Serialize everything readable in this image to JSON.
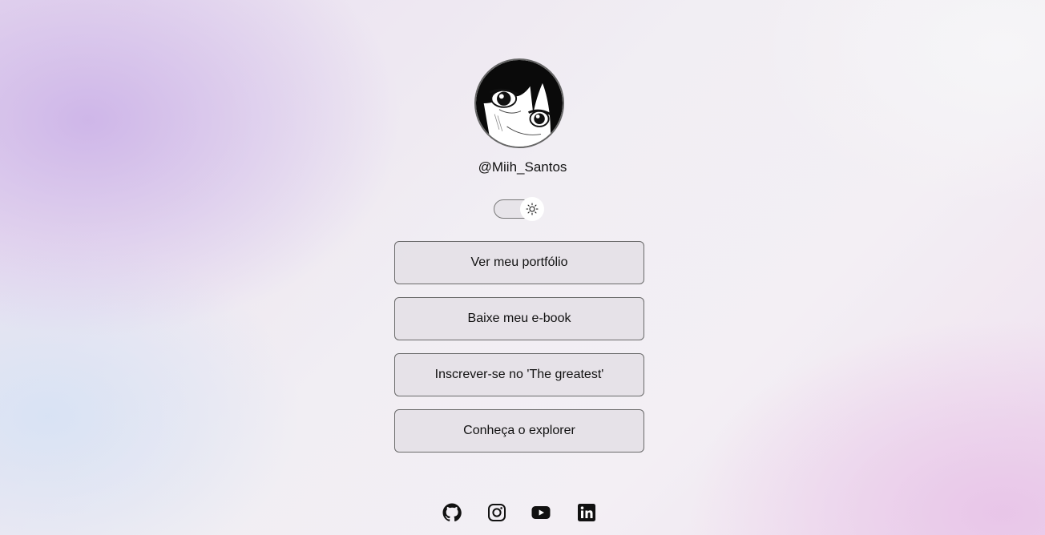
{
  "profile": {
    "handle": "@Miih_Santos",
    "avatar": "manga-girl-portrait"
  },
  "theme_toggle": {
    "state": "light",
    "icon": "sun-icon"
  },
  "links": [
    {
      "label": "Ver meu portfólio"
    },
    {
      "label": "Baixe meu e-book"
    },
    {
      "label": "Inscrever-se no 'The greatest'"
    },
    {
      "label": "Conheça o explorer"
    }
  ],
  "social": [
    {
      "icon": "github-icon"
    },
    {
      "icon": "instagram-icon"
    },
    {
      "icon": "youtube-icon"
    },
    {
      "icon": "linkedin-icon"
    }
  ],
  "colors": {
    "text": "#111111",
    "button_border": "#6a6a6a",
    "background_accent_purple": "#cdb4e8",
    "background_accent_pink": "#e8c4e8"
  }
}
